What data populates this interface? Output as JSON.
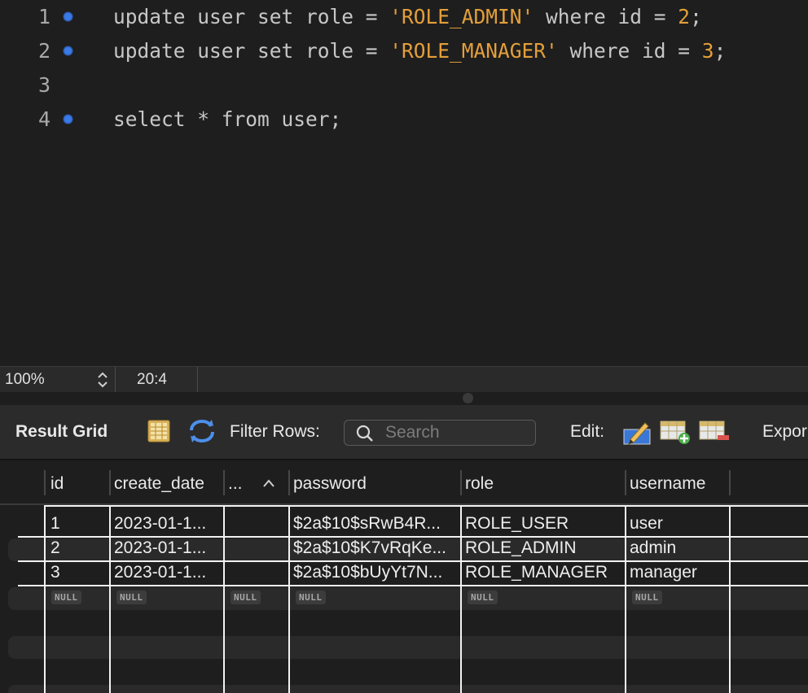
{
  "editor": {
    "lines": [
      {
        "num": "1",
        "has_marker": true,
        "tokens": [
          {
            "t": "update user set role = ",
            "c": "kw"
          },
          {
            "t": "'ROLE_ADMIN'",
            "c": "str"
          },
          {
            "t": " where id = ",
            "c": "kw"
          },
          {
            "t": "2",
            "c": "num"
          },
          {
            "t": ";",
            "c": "kw"
          }
        ]
      },
      {
        "num": "2",
        "has_marker": true,
        "tokens": [
          {
            "t": "update user set role = ",
            "c": "kw"
          },
          {
            "t": "'ROLE_MANAGER'",
            "c": "str"
          },
          {
            "t": " where id = ",
            "c": "kw"
          },
          {
            "t": "3",
            "c": "num"
          },
          {
            "t": ";",
            "c": "kw"
          }
        ]
      },
      {
        "num": "3",
        "has_marker": false,
        "tokens": []
      },
      {
        "num": "4",
        "has_marker": true,
        "tokens": [
          {
            "t": "select * from user;",
            "c": "kw"
          }
        ]
      }
    ]
  },
  "status": {
    "zoom": "100%",
    "cursor": "20:4"
  },
  "toolbar": {
    "title": "Result Grid",
    "filter_label": "Filter Rows:",
    "search_placeholder": "Search",
    "edit_label": "Edit:",
    "export_label": "Expor"
  },
  "grid": {
    "columns": [
      "id",
      "create_date",
      "...",
      "password",
      "role",
      "username"
    ],
    "rows": [
      [
        "1",
        "2023-01-1...",
        "",
        "$2a$10$sRwB4R...",
        "ROLE_USER",
        "user"
      ],
      [
        "2",
        "2023-01-1...",
        "",
        "$2a$10$K7vRqKe...",
        "ROLE_ADMIN",
        "admin"
      ],
      [
        "3",
        "2023-01-1...",
        "",
        "$2a$10$bUyYt7N...",
        "ROLE_MANAGER",
        "manager"
      ]
    ],
    "null_label": "NULL"
  },
  "colors": {
    "string": "#e39f3a",
    "keyword": "#b4b4b4",
    "marker": "#3b7be6"
  }
}
